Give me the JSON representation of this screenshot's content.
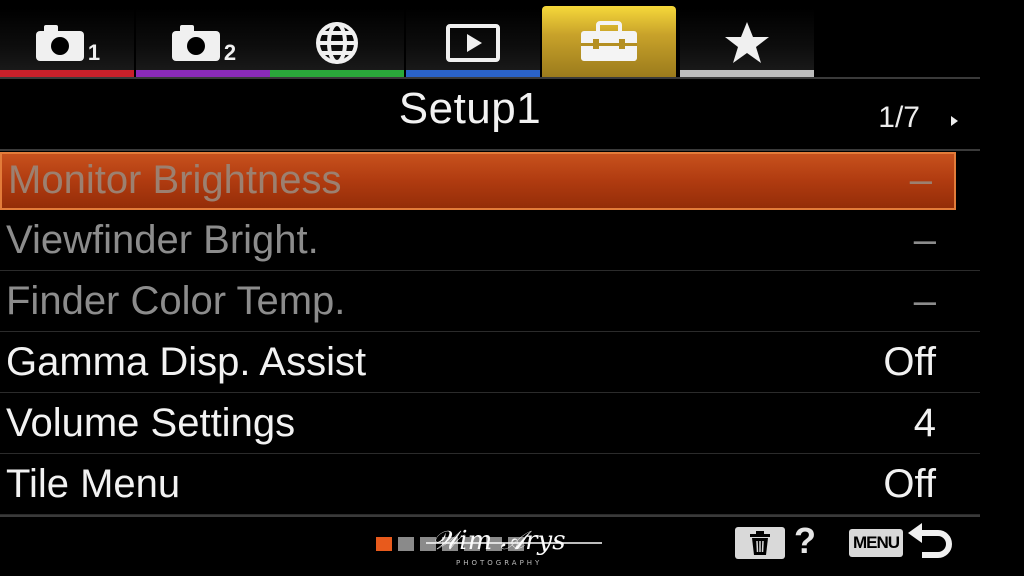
{
  "tabs": [
    {
      "icon": "camera-icon",
      "number": "1",
      "accent": "#c8202a"
    },
    {
      "icon": "camera-icon",
      "number": "2",
      "accent": "#8a2ab8"
    },
    {
      "icon": "globe-icon",
      "number": "",
      "accent": "#2aa83a"
    },
    {
      "icon": "play-icon",
      "number": "",
      "accent": "#2a62c8"
    },
    {
      "icon": "toolbox-icon",
      "number": "",
      "accent": "#f3d23a",
      "active": true
    },
    {
      "icon": "star-icon",
      "number": "",
      "accent": "#bdbdbd"
    }
  ],
  "header": {
    "title": "Setup1",
    "page": "1/7"
  },
  "menu_items": [
    {
      "label": "Monitor Brightness",
      "value": "–",
      "state": "selected-disabled"
    },
    {
      "label": "Viewfinder Bright.",
      "value": "–",
      "state": "disabled"
    },
    {
      "label": "Finder Color Temp.",
      "value": "–",
      "state": "disabled"
    },
    {
      "label": "Gamma Disp. Assist",
      "value": "Off",
      "state": "enabled"
    },
    {
      "label": "Volume Settings",
      "value": "4",
      "state": "enabled"
    },
    {
      "label": "Tile Menu",
      "value": "Off",
      "state": "enabled"
    }
  ],
  "footer": {
    "page_dots": 7,
    "active_dot": 1,
    "help": "?",
    "menu_key": "MENU",
    "watermark_name": "Wim Arys",
    "watermark_sub": "PHOTOGRAPHY"
  },
  "colors": {
    "selection": "#b8431a",
    "active_tab": "#f3d23a",
    "active_dot": "#e85a1c"
  }
}
